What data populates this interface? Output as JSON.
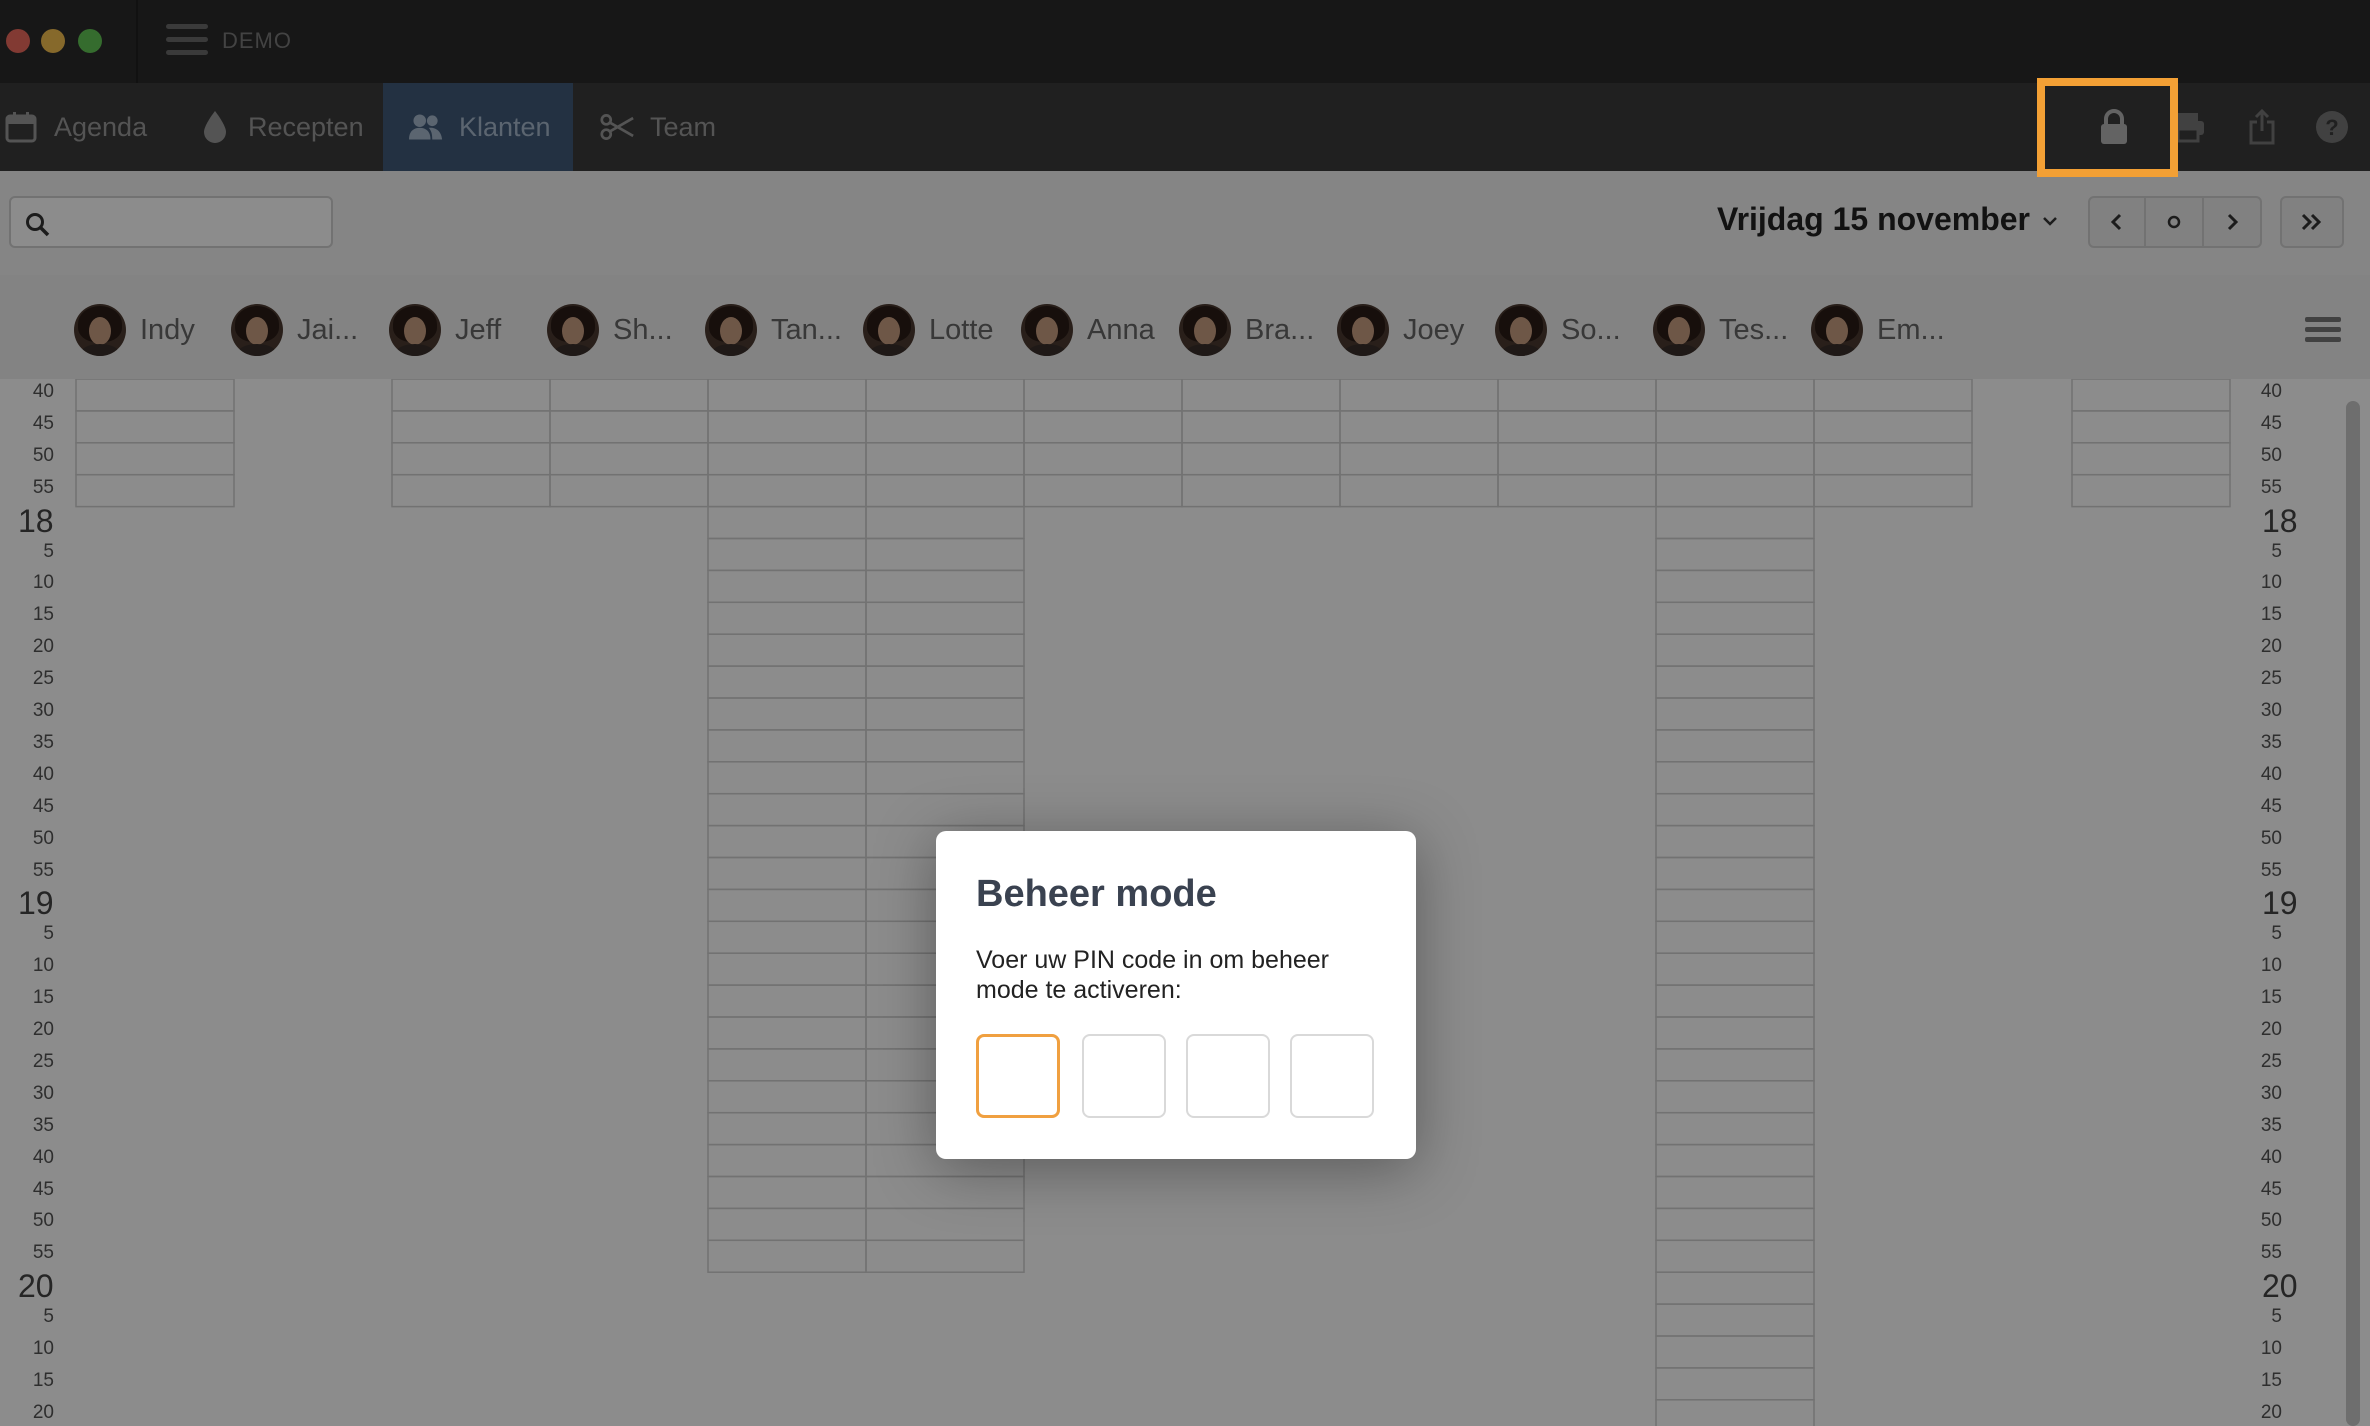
{
  "app": {
    "name": "DEMO"
  },
  "nav": {
    "agenda": "Agenda",
    "recepten": "Recepten",
    "klanten": "Klanten",
    "team": "Team"
  },
  "toolbar_icons": [
    "lock-icon",
    "printer-icon",
    "share-icon",
    "help-icon"
  ],
  "date_header": {
    "title": "Vrijdag 15 november"
  },
  "staff": [
    "Indy",
    "Jai...",
    "Jeff",
    "Sh...",
    "Tan...",
    "Lotte",
    "Anna",
    "Bra...",
    "Joey",
    "So...",
    "Tes...",
    "Em..."
  ],
  "calendar": {
    "minute_labels_top": [
      "40",
      "45",
      "50",
      "55"
    ],
    "hours": [
      {
        "hour": "18",
        "minutes": [
          "5",
          "10",
          "15",
          "20",
          "25",
          "30",
          "35",
          "40",
          "45",
          "50",
          "55"
        ]
      },
      {
        "hour": "19",
        "minutes": [
          "5",
          "10",
          "15",
          "20",
          "25",
          "30",
          "35",
          "40",
          "45",
          "50",
          "55"
        ]
      },
      {
        "hour": "20",
        "minutes": [
          "5",
          "10",
          "15",
          "20"
        ]
      }
    ]
  },
  "modal": {
    "title": "Beheer mode",
    "text": "Voer uw PIN code in om beheer mode te activeren:",
    "pin_length": 4
  },
  "colors": {
    "accent_highlight": "#f3a035",
    "active_tab": "#415a78",
    "titlebar": "#2a2a2a",
    "toolbar": "#3b3b3b"
  }
}
